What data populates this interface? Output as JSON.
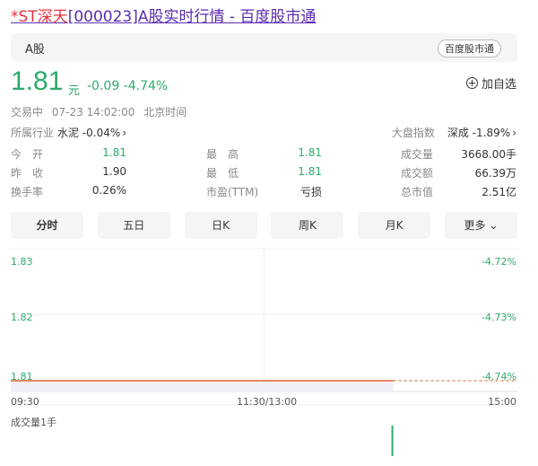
{
  "page": {
    "title_prefix": "*ST深天",
    "title_rest": "[000023]A股实时行情 - 百度股市通"
  },
  "tabbar": {
    "tab": "A股",
    "brand": "百度股市通"
  },
  "quote": {
    "price": "1.81",
    "unit": "元",
    "change": "-0.09 -4.74%",
    "watch_label": "加自选",
    "status": "交易中",
    "datetime": "07-23 14:02:00",
    "timezone": "北京时间",
    "industry_label": "所属行业",
    "industry_value": "水泥 -0.04%",
    "index_label": "大盘指数",
    "index_value": "深成 -1.89%",
    "colors": {
      "down": "#2bab6a",
      "title_red": "#e0303b",
      "title_link": "#5b2bb0"
    }
  },
  "stats": [
    [
      {
        "label": "今　开",
        "value": "1.81",
        "color": "green"
      },
      {
        "label": "最　高",
        "value": "1.81",
        "color": "green"
      },
      {
        "label": "成交量",
        "value": "3668.00手",
        "color": "plain"
      }
    ],
    [
      {
        "label": "昨　收",
        "value": "1.90",
        "color": "plain"
      },
      {
        "label": "最　低",
        "value": "1.81",
        "color": "green"
      },
      {
        "label": "成交额",
        "value": "66.39万",
        "color": "plain"
      }
    ],
    [
      {
        "label": "换手率",
        "value": "0.26%",
        "color": "plain"
      },
      {
        "label": "市盈(TTM)",
        "value": "亏损",
        "color": "plain"
      },
      {
        "label": "总市值",
        "value": "2.51亿",
        "color": "plain"
      }
    ]
  ],
  "periods": [
    "分时",
    "五日",
    "日K",
    "周K",
    "月K",
    "更多"
  ],
  "chart_data": {
    "type": "line",
    "y_ticks": [
      "1.83",
      "1.82",
      "1.81"
    ],
    "pct_ticks": [
      "-4.72%",
      "-4.73%",
      "-4.74%"
    ],
    "x_ticks": [
      "09:30",
      "11:30/13:00",
      "15:00"
    ],
    "ylim": [
      1.81,
      1.83
    ],
    "series": [
      {
        "values": [
          1.81,
          1.81,
          1.81,
          1.81,
          1.81,
          1.81,
          1.81,
          1.81,
          1.81,
          1.81
        ]
      }
    ],
    "volume_label": "成交量1手"
  }
}
